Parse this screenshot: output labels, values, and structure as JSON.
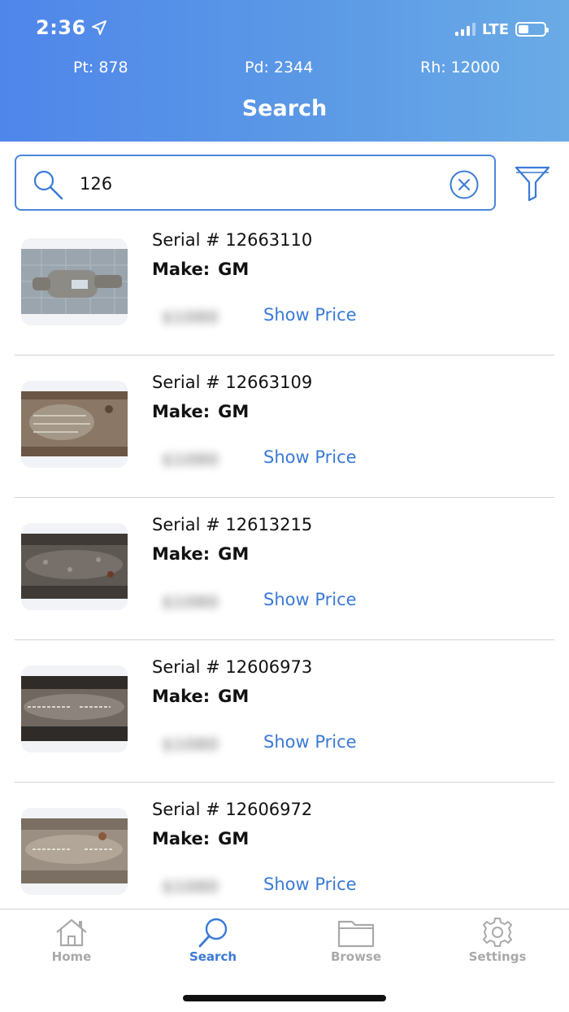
{
  "status_bar": {
    "time": "2:36",
    "network": "LTE"
  },
  "metals": {
    "pt": "Pt: 878",
    "pd": "Pd: 2344",
    "rh": "Rh: 12000"
  },
  "page_title": "Search",
  "search": {
    "value": "126"
  },
  "results": [
    {
      "serial": "Serial # 12663110",
      "make_label": "Make:",
      "make": "GM",
      "price_hidden": "$1080",
      "show_price": "Show Price"
    },
    {
      "serial": "Serial # 12663109",
      "make_label": "Make:",
      "make": "GM",
      "price_hidden": "$1080",
      "show_price": "Show Price"
    },
    {
      "serial": "Serial # 12613215",
      "make_label": "Make:",
      "make": "GM",
      "price_hidden": "$1080",
      "show_price": "Show Price"
    },
    {
      "serial": "Serial # 12606973",
      "make_label": "Make:",
      "make": "GM",
      "price_hidden": "$1080",
      "show_price": "Show Price"
    },
    {
      "serial": "Serial # 12606972",
      "make_label": "Make:",
      "make": "GM",
      "price_hidden": "$1080",
      "show_price": "Show Price"
    }
  ],
  "tabbar": {
    "home": "Home",
    "search": "Search",
    "browse": "Browse",
    "settings": "Settings"
  },
  "colors": {
    "accent": "#3a7ad6",
    "header_start": "#4f86ea",
    "header_end": "#6aabe6",
    "inactive_tab": "#a9a9a9"
  },
  "icons": [
    "location-arrow-icon",
    "signal-icon",
    "battery-icon",
    "search-icon",
    "clear-icon",
    "filter-icon",
    "home-icon",
    "search-tab-icon",
    "folder-icon",
    "gear-icon"
  ]
}
